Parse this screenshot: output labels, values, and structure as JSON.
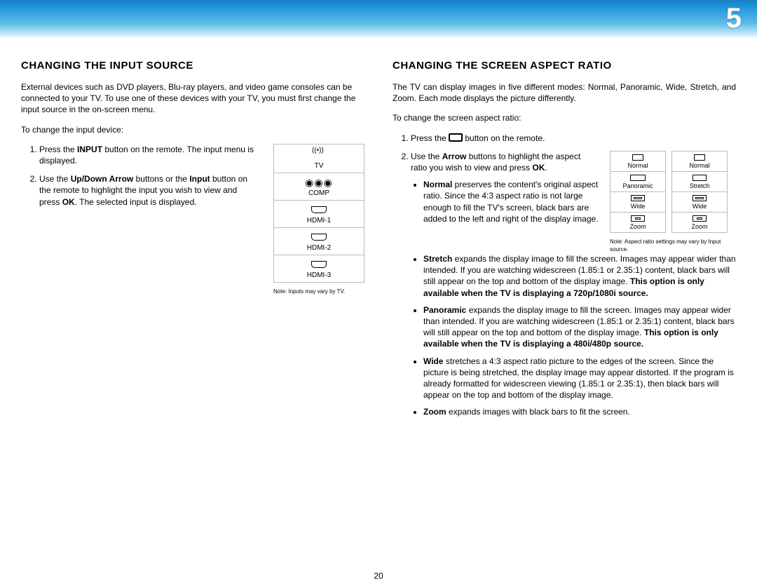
{
  "header": {
    "chapter": "5"
  },
  "pageNumber": "20",
  "left": {
    "heading": "CHANGING THE INPUT SOURCE",
    "intro": "External devices such as DVD players, Blu-ray players, and video game consoles can be connected to your TV.  To use one of these devices with your TV, you must first change the input source in the on-screen menu.",
    "lead": "To change the input device:",
    "step1_a": "Press the ",
    "step1_b": "INPUT",
    "step1_c": " button on the remote. The input menu is displayed.",
    "step2_a": "Use the ",
    "step2_b": "Up/Down Arrow",
    "step2_c": " buttons or the ",
    "step2_d": "Input",
    "step2_e": " button on the remote to highlight the input you wish to view and press ",
    "step2_f": "OK",
    "step2_g": ". The selected input is displayed.",
    "menu": {
      "tv": "TV",
      "comp": "COMP",
      "h1": "HDMI-1",
      "h2": "HDMI-2",
      "h3": "HDMI-3"
    },
    "note": "Note: Inputs may vary by TV."
  },
  "right": {
    "heading": "CHANGING THE SCREEN ASPECT RATIO",
    "intro": "The TV can display images in five different modes: Normal, Panoramic, Wide, Stretch, and Zoom. Each mode displays the picture differently.",
    "lead": "To change the screen aspect ratio:",
    "step1_a": "Press the ",
    "step1_b": " button on the remote.",
    "step2_a": "Use the ",
    "step2_b": "Arrow",
    "step2_c": " buttons to highlight the aspect ratio you wish to view and press ",
    "step2_d": "OK",
    "step2_e": ".",
    "bullets": {
      "normal_b": "Normal",
      "normal_t": " preserves the content's original aspect ratio. Since the 4:3 aspect ratio is not large enough to fill the TV's screen, black bars are added to the left and right of the display image.",
      "stretch_b": "Stretch",
      "stretch_t": " expands the display image to fill the screen. Images may appear wider than intended. If you are watching widescreen (1.85:1 or 2.35:1) content, black bars will still appear on the top and bottom of the display image. ",
      "stretch_bold": "This option is only available when the TV is displaying a 720p/1080i source.",
      "pano_b": "Panoramic",
      "pano_t": " expands the display image to fill the screen. Images may appear wider than intended. If you are watching widescreen (1.85:1 or 2.35:1) content, black bars will still appear on the top and bottom of the display image. ",
      "pano_bold": "This option is only available when the TV is displaying a 480i/480p source.",
      "wide_b": "Wide",
      "wide_t": " stretches a 4:3 aspect ratio picture to the edges of the screen. Since the picture is being stretched, the display image may appear distorted. If the program is already formatted for widescreen viewing (1.85:1 or 2.35:1), then black bars will appear on the top and bottom of the display image.",
      "zoom_b": "Zoom",
      "zoom_t": " expands images with black bars to fit the screen."
    },
    "arTable1": {
      "r0": "Normal",
      "r1": "Panoramic",
      "r2": "Wide",
      "r3": "Zoom"
    },
    "arTable2": {
      "r0": "Normal",
      "r1": "Stretch",
      "r2": "Wide",
      "r3": "Zoom"
    },
    "note": "Note: Aspect ratio settings may vary by Input source."
  }
}
